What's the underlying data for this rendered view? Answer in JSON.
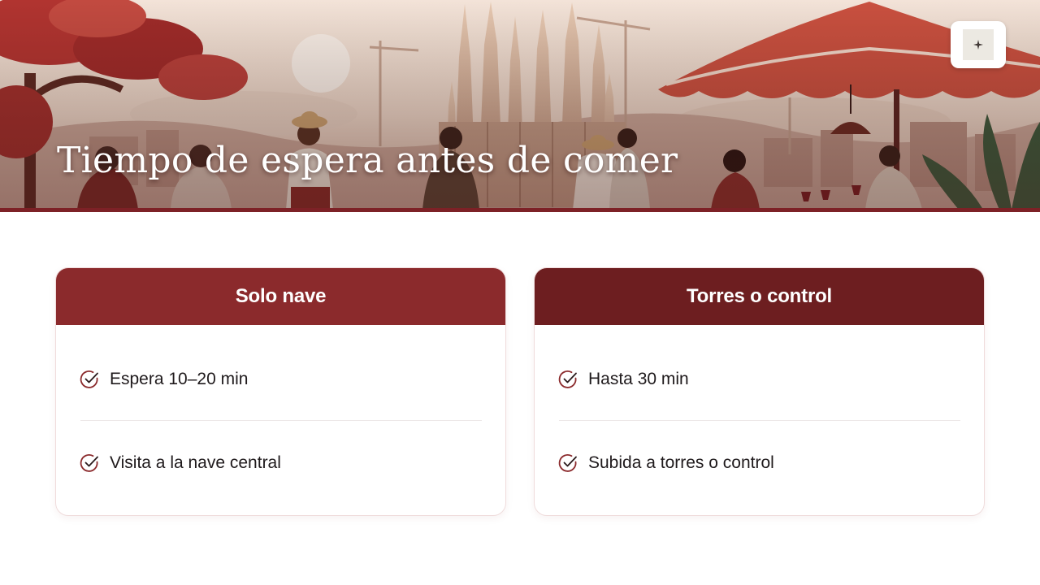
{
  "hero": {
    "title": "Tiempo de espera antes de comer",
    "illustration_icon": "basilica-cafe-scene",
    "logo_icon": "compass-rose-icon"
  },
  "colors": {
    "accent_dark": "#6d1e20",
    "accent": "#8b2a2c",
    "hero_rule": "#7d2126"
  },
  "cards": [
    {
      "title": "Solo nave",
      "items": [
        {
          "icon": "check-circle-icon",
          "label": "Espera 10–20 min"
        },
        {
          "icon": "check-circle-icon",
          "label": "Visita a la nave central"
        }
      ]
    },
    {
      "title": "Torres o control",
      "items": [
        {
          "icon": "check-circle-icon",
          "label": "Hasta 30 min"
        },
        {
          "icon": "check-circle-icon",
          "label": "Subida a torres o control"
        }
      ]
    }
  ]
}
